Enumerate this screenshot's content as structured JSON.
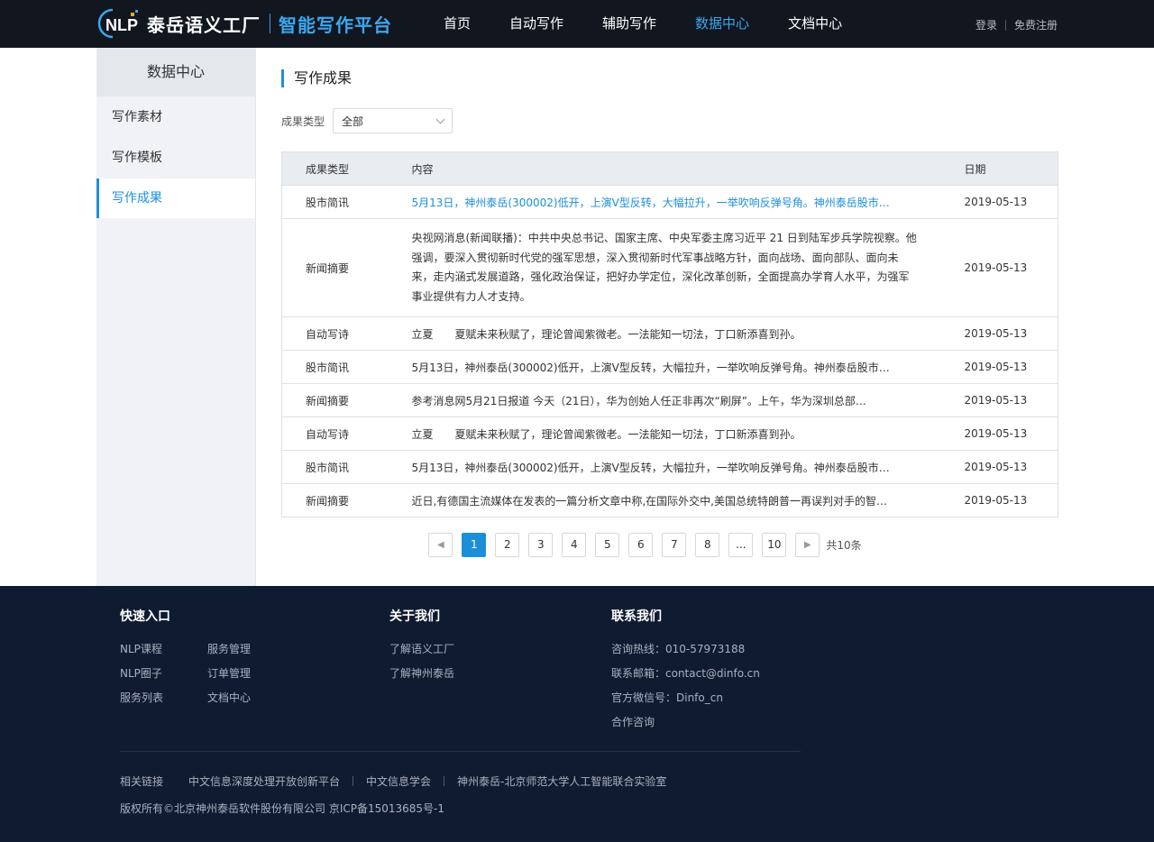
{
  "header": {
    "logo_mark": "NLP",
    "logo_text": "泰岳语义工厂",
    "logo_sub": "智能写作平台",
    "nav": [
      "首页",
      "自动写作",
      "辅助写作",
      "数据中心",
      "文档中心"
    ],
    "nav_active_index": 3,
    "login": "登录",
    "register": "免费注册"
  },
  "sidebar": {
    "title": "数据中心",
    "items": [
      "写作素材",
      "写作模板",
      "写作成果"
    ],
    "active_index": 2
  },
  "main": {
    "section_title": "写作成果",
    "filter_label": "成果类型",
    "filter_value": "全部",
    "columns": [
      "成果类型",
      "内容",
      "日期"
    ],
    "rows": [
      {
        "type": "股市简讯",
        "content": "5月13日，神州泰岳(300002)低开，上演V型反转，大幅拉升，一举吹响反弹号角。神州泰岳股市…",
        "date": "2019-05-13"
      },
      {
        "type": "新闻摘要",
        "content": "央视网消息(新闻联播)：中共中央总书记、国家主席、中央军委主席习近平 21 日到陆军步兵学院视察。他强调，要深入贯彻新时代党的强军思想，深入贯彻新时代军事战略方针，面向战场、面向部队、面向未来，走内涵式发展道路，强化政治保证，把好办学定位，深化改革创新，全面提高办学育人水平，为强军事业提供有力人才支持。",
        "date": "2019-05-13"
      },
      {
        "type": "自动写诗",
        "content": "立夏　　夏赋未来秋赋了，理论曾闻紫微老。一法能知一切法，丁口新添喜到孙。",
        "date": "2019-05-13"
      },
      {
        "type": "股市简讯",
        "content": "5月13日，神州泰岳(300002)低开，上演V型反转，大幅拉升，一举吹响反弹号角。神州泰岳股市…",
        "date": "2019-05-13"
      },
      {
        "type": "新闻摘要",
        "content": "参考消息网5月21日报道 今天（21日），华为创始人任正非再次“刷屏”。上午，华为深圳总部…",
        "date": "2019-05-13"
      },
      {
        "type": "自动写诗",
        "content": "立夏　　夏赋未来秋赋了，理论曾闻紫微老。一法能知一切法，丁口新添喜到孙。",
        "date": "2019-05-13"
      },
      {
        "type": "股市简讯",
        "content": "5月13日，神州泰岳(300002)低开，上演V型反转，大幅拉升，一举吹响反弹号角。神州泰岳股市…",
        "date": "2019-05-13"
      },
      {
        "type": "新闻摘要",
        "content": "近日,有德国主流媒体在发表的一篇分析文章中称,在国际外交中,美国总统特朗普一再误判对手的智…",
        "date": "2019-05-13"
      }
    ],
    "highlighted_row_index": 0,
    "pagination": {
      "prev": "◀",
      "next": "▶",
      "pages": [
        "1",
        "2",
        "3",
        "4",
        "5",
        "6",
        "7",
        "8",
        "...",
        "10"
      ],
      "current": "1",
      "total": "共10条"
    }
  },
  "footer": {
    "quick_title": "快速入口",
    "quick_links": [
      "NLP课程",
      "服务管理",
      "NLP圈子",
      "订单管理",
      "服务列表",
      "文档中心"
    ],
    "about_title": "关于我们",
    "about_links": [
      "了解语义工厂",
      "了解神州泰岳"
    ],
    "contact_title": "联系我们",
    "contact_items": [
      "咨询热线：010-57973188",
      "联系邮箱：contact@dinfo.cn",
      "官方微信号：Dinfo_cn",
      "合作咨询"
    ],
    "related_label": "相关链接",
    "related_links": [
      "中文信息深度处理开放创新平台",
      "中文信息学会",
      "神州泰岳-北京师范大学人工智能联合实验室"
    ],
    "copyright": "版权所有©北京神州泰岳软件股份有限公司  京ICP备15013685号-1"
  },
  "colors": {
    "header_bg": "#11161f",
    "accent": "#1d8fd9",
    "footer_bg": "#0f1b31"
  }
}
